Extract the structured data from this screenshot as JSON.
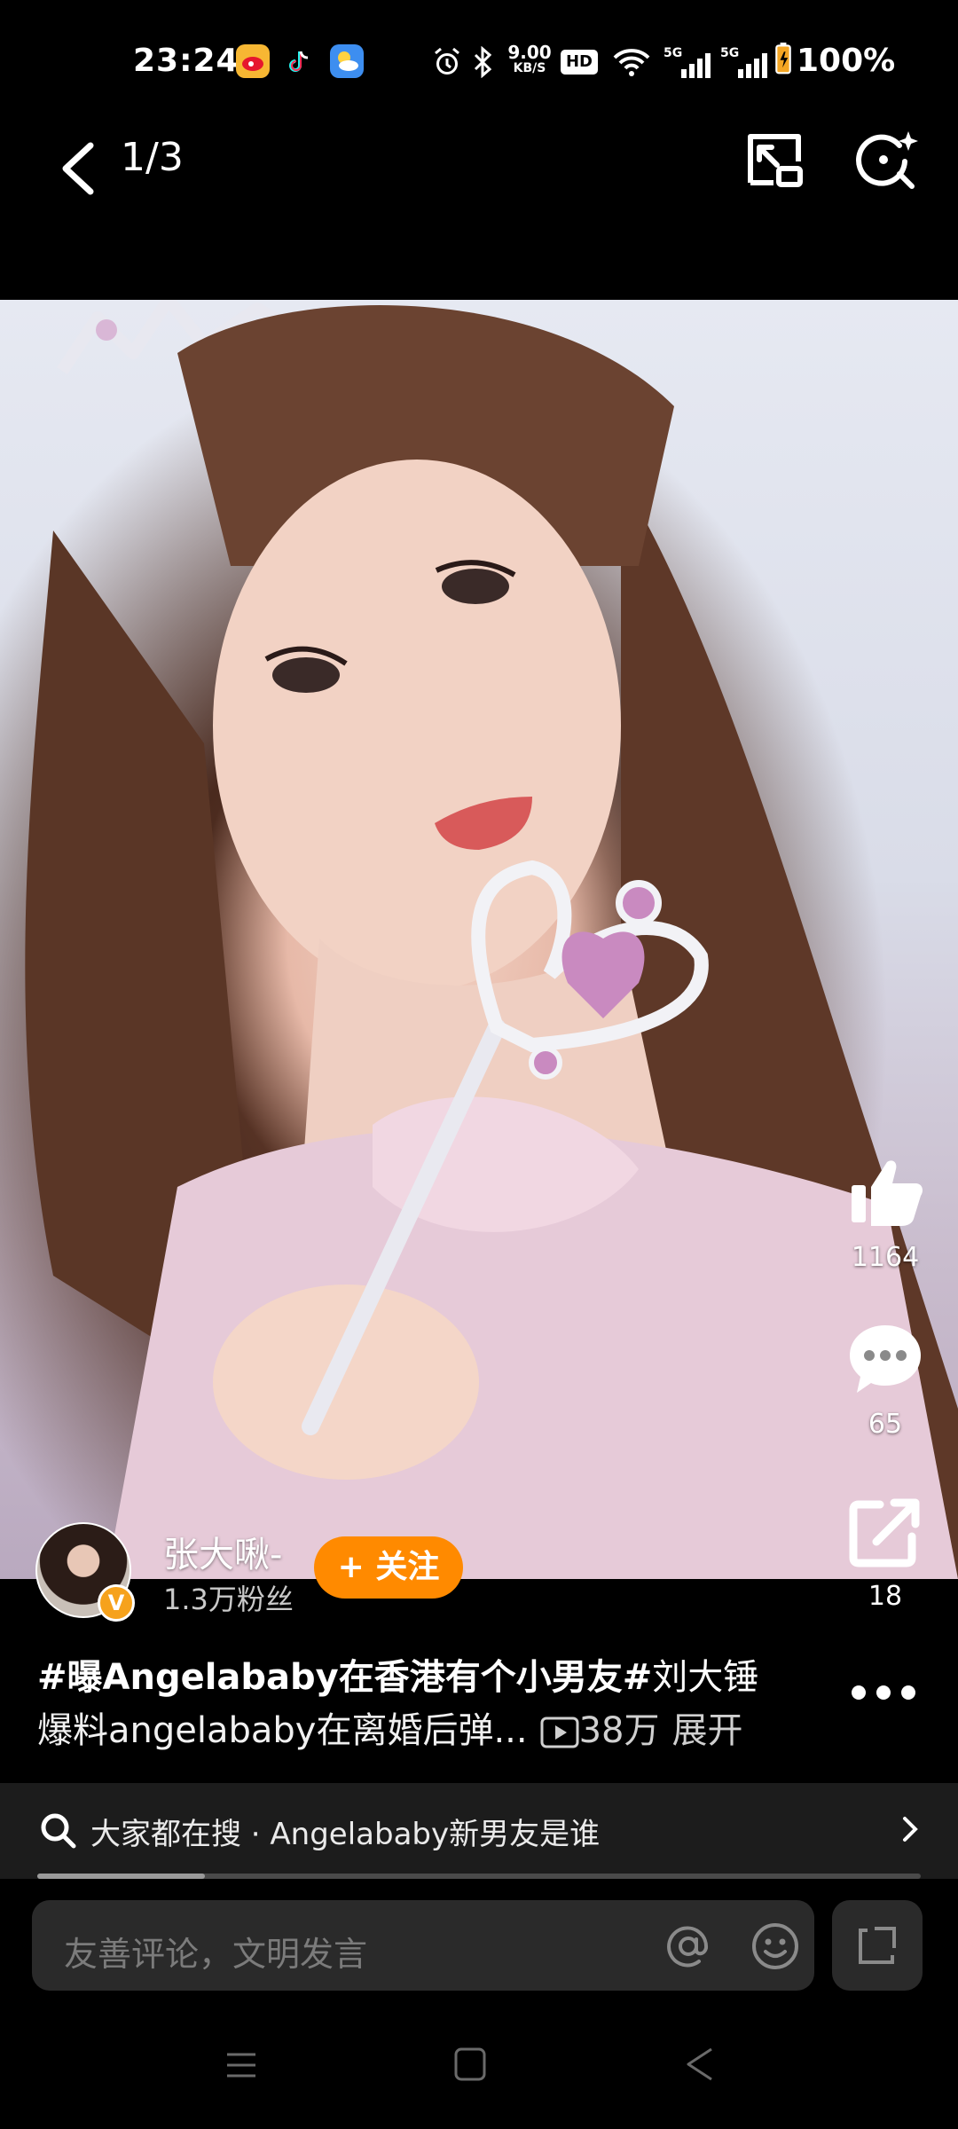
{
  "status_bar": {
    "time": "23:24",
    "app_icons": [
      "weibo-icon",
      "tiktok-icon",
      "weather-icon"
    ],
    "network_speed_value": "9.00",
    "network_speed_unit": "KB/S",
    "hd_label": "HD",
    "signal_1_label": "5G",
    "signal_2_label": "5G",
    "battery": "100%"
  },
  "nav": {
    "page_indicator": "1/3"
  },
  "actions": {
    "likes": "1164",
    "comments": "65",
    "shares": "18"
  },
  "author": {
    "name": "张大啾-",
    "followers": "1.3万粉丝",
    "verified_label": "V",
    "follow_label": "+ 关注"
  },
  "caption": {
    "topic": "#曝Angelababy在香港有个小男友#",
    "mention": "刘大锤",
    "text": "爆料angelababy在离婚后弹...",
    "views": "38万",
    "expand": "展开"
  },
  "search_suggestion": {
    "text": "大家都在搜 · Angelababy新男友是谁",
    "progress": 0.19
  },
  "comment": {
    "placeholder": "友善评论，文明发言"
  },
  "colors": {
    "follow_button": "#ff8a00",
    "background": "#000000",
    "verified_badge": "#f6a21c"
  }
}
